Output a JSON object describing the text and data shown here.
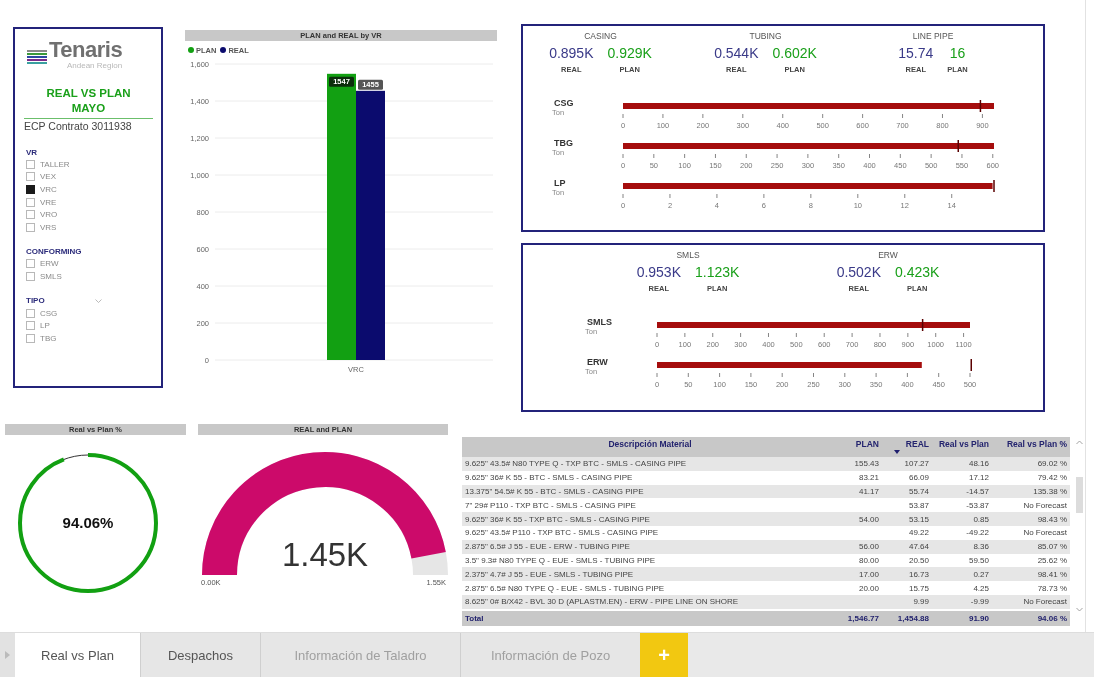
{
  "logo": {
    "brand": "Tenaris",
    "region": "Andean Region"
  },
  "report_title": "REAL VS PLAN MAYO",
  "contract": "ECP Contrato 3011938",
  "slicers": [
    {
      "title": "VR",
      "dropdown": false,
      "items": [
        {
          "label": "TALLER",
          "checked": false
        },
        {
          "label": "VEX",
          "checked": false
        },
        {
          "label": "VRC",
          "checked": true
        },
        {
          "label": "VRE",
          "checked": false
        },
        {
          "label": "VRO",
          "checked": false
        },
        {
          "label": "VRS",
          "checked": false
        }
      ]
    },
    {
      "title": "CONFORMING",
      "dropdown": false,
      "items": [
        {
          "label": "ERW",
          "checked": false
        },
        {
          "label": "SMLS",
          "checked": false
        }
      ]
    },
    {
      "title": "TIPO",
      "dropdown": true,
      "items": [
        {
          "label": "CSG",
          "checked": false
        },
        {
          "label": "LP",
          "checked": false
        },
        {
          "label": "TBG",
          "checked": false
        }
      ]
    }
  ],
  "bar_chart": {
    "chart_data": {
      "type": "bar",
      "title": "PLAN and REAL by VR",
      "categories": [
        "VRC"
      ],
      "series": [
        {
          "name": "PLAN",
          "color": "#12a012",
          "values": [
            1547
          ]
        },
        {
          "name": "REAL",
          "color": "#0b0b6e",
          "values": [
            1455
          ]
        }
      ],
      "grid": true,
      "ylim": [
        0,
        1600
      ],
      "yticks": [
        0,
        200,
        400,
        600,
        800,
        {
          "value": 1000,
          "label": "1,000"
        },
        {
          "value": 1200,
          "label": "1,200"
        },
        {
          "value": 1400,
          "label": "1,400"
        },
        {
          "value": 1600,
          "label": "1,600"
        }
      ],
      "data_labels": true
    }
  },
  "bullet_cards": [
    {
      "kpis": [
        {
          "title": "CASING",
          "real": "0.895K",
          "real_label": "REAL",
          "plan": "0.929K",
          "plan_label": "PLAN"
        },
        {
          "title": "TUBING",
          "real": "0.544K",
          "real_label": "REAL",
          "plan": "0.602K",
          "plan_label": "PLAN"
        },
        {
          "title": "LINE PIPE",
          "real": "15.74",
          "real_label": "REAL",
          "plan": "16",
          "plan_label": "PLAN"
        }
      ],
      "bullets": [
        {
          "chart_data": {
            "type": "bar",
            "orientation": "horizontal",
            "categories": [
              "CSG"
            ],
            "ylabel": "Ton",
            "series": [
              {
                "color": "#a50d0d",
                "values": [
                  929
                ]
              }
            ],
            "xlim": [
              0,
              929
            ],
            "xticks": [
              0,
              100,
              200,
              300,
              400,
              500,
              600,
              700,
              800,
              900
            ],
            "ref_lines": [
              {
                "axis": "x",
                "value": 895
              }
            ]
          }
        },
        {
          "chart_data": {
            "type": "bar",
            "orientation": "horizontal",
            "categories": [
              "TBG"
            ],
            "ylabel": "Ton",
            "series": [
              {
                "color": "#a50d0d",
                "values": [
                  602
                ]
              }
            ],
            "xlim": [
              0,
              602
            ],
            "xticks": [
              0,
              50,
              100,
              150,
              200,
              250,
              300,
              350,
              400,
              450,
              500,
              550,
              600
            ],
            "ref_lines": [
              {
                "axis": "x",
                "value": 544
              }
            ]
          }
        },
        {
          "chart_data": {
            "type": "bar",
            "orientation": "horizontal",
            "categories": [
              "LP"
            ],
            "ylabel": "Ton",
            "series": [
              {
                "color": "#a50d0d",
                "values": [
                  15.74
                ]
              }
            ],
            "xlim": [
              0,
              15.8
            ],
            "xticks": [
              0,
              2,
              4,
              6,
              8,
              10,
              12,
              14
            ],
            "ref_lines": [
              {
                "axis": "x",
                "value": 15.8
              }
            ]
          }
        }
      ]
    },
    {
      "kpis": [
        {
          "title": "SMLS",
          "real": "0.953K",
          "real_label": "REAL",
          "plan": "1.123K",
          "plan_label": "PLAN"
        },
        {
          "title": "ERW",
          "real": "0.502K",
          "real_label": "REAL",
          "plan": "0.423K",
          "plan_label": "PLAN"
        }
      ],
      "bullets": [
        {
          "chart_data": {
            "type": "bar",
            "orientation": "horizontal",
            "categories": [
              "SMLS"
            ],
            "ylabel": "Ton",
            "series": [
              {
                "color": "#a50d0d",
                "values": [
                  1123
                ]
              }
            ],
            "xlim": [
              0,
              1123
            ],
            "xticks": [
              0,
              100,
              200,
              300,
              400,
              500,
              600,
              700,
              800,
              900,
              1000,
              1100
            ],
            "ref_lines": [
              {
                "axis": "x",
                "value": 953
              }
            ]
          }
        },
        {
          "chart_data": {
            "type": "bar",
            "orientation": "horizontal",
            "categories": [
              "ERW"
            ],
            "ylabel": "Ton",
            "series": [
              {
                "color": "#a50d0d",
                "values": [
                  423
                ]
              }
            ],
            "xlim": [
              0,
              500
            ],
            "xticks": [
              0,
              50,
              100,
              150,
              200,
              250,
              300,
              350,
              400,
              450,
              500
            ],
            "ref_lines": [
              {
                "axis": "x",
                "value": 502
              }
            ]
          }
        }
      ]
    }
  ],
  "ring_gauge": {
    "title": "Real vs Plan %",
    "value": "94.06%"
  },
  "arc_gauge": {
    "title": "REAL and PLAN",
    "value": "1.45K",
    "min": "0.00K",
    "max": "1.55K"
  },
  "table": {
    "columns": [
      {
        "label": "Descripción Material",
        "sorted": false
      },
      {
        "label": "PLAN",
        "sorted": false
      },
      {
        "label": "REAL",
        "sorted": true
      },
      {
        "label": "Real vs Plan",
        "sorted": false
      },
      {
        "label": "Real vs Plan %",
        "sorted": false
      }
    ],
    "rows": [
      [
        "9.625\" 43.5# N80 TYPE Q - TXP BTC - SMLS - CASING PIPE",
        "155.43",
        "107.27",
        "48.16",
        "69.02 %"
      ],
      [
        "9.625\" 36# K 55 - BTC - SMLS - CASING PIPE",
        "83.21",
        "66.09",
        "17.12",
        "79.42 %"
      ],
      [
        "13.375\" 54.5# K 55 - BTC - SMLS - CASING PIPE",
        "41.17",
        "55.74",
        "-14.57",
        "135.38 %"
      ],
      [
        "7\" 29# P110 - TXP BTC - SMLS - CASING PIPE",
        "",
        "53.87",
        "-53.87",
        "No Forecast"
      ],
      [
        "9.625\" 36# K 55 - TXP BTC - SMLS - CASING PIPE",
        "54.00",
        "53.15",
        "0.85",
        "98.43 %"
      ],
      [
        "9.625\" 43.5# P110 - TXP BTC - SMLS - CASING PIPE",
        "",
        "49.22",
        "-49.22",
        "No Forecast"
      ],
      [
        "2.875\" 6.5# J 55 - EUE - ERW - TUBING PIPE",
        "56.00",
        "47.64",
        "8.36",
        "85.07 %"
      ],
      [
        "3.5\" 9.3# N80 TYPE Q - EUE - SMLS - TUBING PIPE",
        "80.00",
        "20.50",
        "59.50",
        "25.62 %"
      ],
      [
        "2.375\" 4.7# J 55 - EUE - SMLS - TUBING PIPE",
        "17.00",
        "16.73",
        "0.27",
        "98.41 %"
      ],
      [
        "2.875\" 6.5# N80 TYPE Q - EUE - SMLS - TUBING PIPE",
        "20.00",
        "15.75",
        "4.25",
        "78.73 %"
      ],
      [
        "8.625\" 0# B/X42 - BVL 30 D (APLASTM.EN) - ERW - PIPE LINE ON SHORE",
        "",
        "9.99",
        "-9.99",
        "No Forecast"
      ]
    ],
    "total": [
      "Total",
      "1,546.77",
      "1,454.88",
      "91.90",
      "94.06 %"
    ]
  },
  "tabs": [
    {
      "label": "Real vs Plan",
      "selected": true,
      "disabled": false
    },
    {
      "label": "Despachos",
      "selected": false,
      "disabled": false
    },
    {
      "label": "Información de Taladro",
      "selected": false,
      "disabled": true
    },
    {
      "label": "Información de Pozo",
      "selected": false,
      "disabled": true
    }
  ],
  "add_page_button": "+"
}
